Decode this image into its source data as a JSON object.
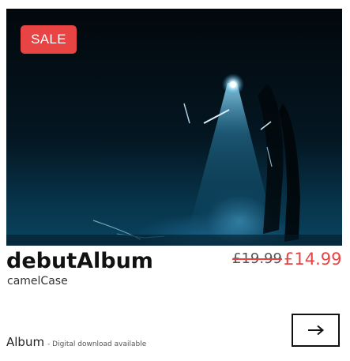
{
  "product": {
    "badge": "SALE",
    "title": "debutAlbum",
    "artist": "camelCase",
    "price_original": "£19.99",
    "price_sale": "£14.99",
    "format": "Album",
    "format_note": "- Digital download available"
  },
  "icons": {
    "go": "arrow-right-icon"
  },
  "colors": {
    "accent": "#e84444",
    "text": "#111111",
    "button_border": "#111111"
  }
}
